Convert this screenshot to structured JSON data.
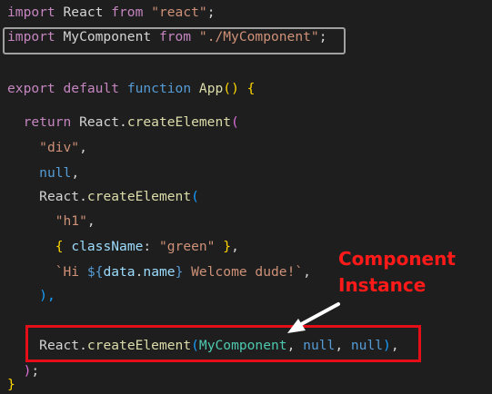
{
  "colors": {
    "background": "#1e1e1e",
    "keyword_control": "#c586c0",
    "keyword": "#569cd6",
    "string": "#ce9178",
    "function": "#dcdcaa",
    "variable": "#9cdcfe",
    "type": "#4ec9b0",
    "text": "#d4d4d4",
    "bracket_gold": "#ffd700",
    "bracket_pink": "#da70d6",
    "bracket_blue": "#179fff",
    "highlight_gray_border": "#a0a0a0",
    "highlight_red_border": "#e30e17",
    "annotation": "#ff1a1a",
    "arrow": "#ffffff"
  },
  "code_lines": [
    [
      [
        "import",
        "keyword_control"
      ],
      [
        " React ",
        "text"
      ],
      [
        "from",
        "keyword_control"
      ],
      [
        " ",
        "text"
      ],
      [
        "\"react\"",
        "string"
      ],
      [
        ";",
        "text"
      ]
    ],
    [
      [
        "import",
        "keyword_control"
      ],
      [
        " MyComponent ",
        "text"
      ],
      [
        "from",
        "keyword_control"
      ],
      [
        " ",
        "text"
      ],
      [
        "\"./MyComponent\"",
        "string"
      ],
      [
        ";",
        "text"
      ]
    ],
    [],
    [
      [
        "export",
        "keyword_control"
      ],
      [
        " ",
        "text"
      ],
      [
        "default",
        "keyword_control"
      ],
      [
        " ",
        "text"
      ],
      [
        "function",
        "keyword"
      ],
      [
        " ",
        "text"
      ],
      [
        "App",
        "function"
      ],
      [
        "(",
        "bracket_gold"
      ],
      [
        ")",
        "bracket_gold"
      ],
      [
        " ",
        "text"
      ],
      [
        "{",
        "bracket_gold"
      ]
    ],
    [],
    [
      [
        "  ",
        "text"
      ],
      [
        "return",
        "keyword_control"
      ],
      [
        " React",
        "text"
      ],
      [
        ".",
        "text"
      ],
      [
        "createElement",
        "function"
      ],
      [
        "(",
        "bracket_pink"
      ]
    ],
    [
      [
        "    ",
        "text"
      ],
      [
        "\"div\"",
        "string"
      ],
      [
        ",",
        "text"
      ]
    ],
    [
      [
        "    ",
        "text"
      ],
      [
        "null",
        "keyword"
      ],
      [
        ",",
        "text"
      ]
    ],
    [
      [
        "    ",
        "text"
      ],
      [
        "React",
        "text"
      ],
      [
        ".",
        "text"
      ],
      [
        "createElement",
        "function"
      ],
      [
        "(",
        "bracket_blue"
      ]
    ],
    [
      [
        "      ",
        "text"
      ],
      [
        "\"h1\"",
        "string"
      ],
      [
        ",",
        "text"
      ]
    ],
    [
      [
        "      ",
        "text"
      ],
      [
        "{",
        "bracket_gold"
      ],
      [
        " ",
        "text"
      ],
      [
        "className",
        "variable"
      ],
      [
        ": ",
        "text"
      ],
      [
        "\"green\"",
        "string"
      ],
      [
        " ",
        "text"
      ],
      [
        "}",
        "bracket_gold"
      ],
      [
        ",",
        "text"
      ]
    ],
    [
      [
        "      ",
        "text"
      ],
      [
        "`Hi ",
        "string"
      ],
      [
        "${",
        "keyword"
      ],
      [
        "data",
        "variable"
      ],
      [
        ".",
        "text"
      ],
      [
        "name",
        "variable"
      ],
      [
        "}",
        "keyword"
      ],
      [
        " Welcome dude!`",
        "string"
      ],
      [
        ",",
        "text"
      ]
    ],
    [
      [
        "    ",
        "text"
      ],
      [
        "),",
        "bracket_blue"
      ]
    ],
    [],
    [
      [
        "    ",
        "text"
      ],
      [
        "React",
        "text"
      ],
      [
        ".",
        "text"
      ],
      [
        "createElement",
        "function"
      ],
      [
        "(",
        "bracket_blue"
      ],
      [
        "MyComponent",
        "type"
      ],
      [
        ", ",
        "text"
      ],
      [
        "null",
        "keyword"
      ],
      [
        ", ",
        "text"
      ],
      [
        "null",
        "keyword"
      ],
      [
        ")",
        "bracket_blue"
      ],
      [
        ",",
        "text"
      ]
    ],
    [
      [
        "  ",
        "text"
      ],
      [
        ")",
        "bracket_pink"
      ],
      [
        ";",
        "text"
      ]
    ],
    [
      [
        "}",
        "bracket_gold"
      ]
    ]
  ],
  "annotation": {
    "line1": "Component",
    "line2": "Instance"
  }
}
